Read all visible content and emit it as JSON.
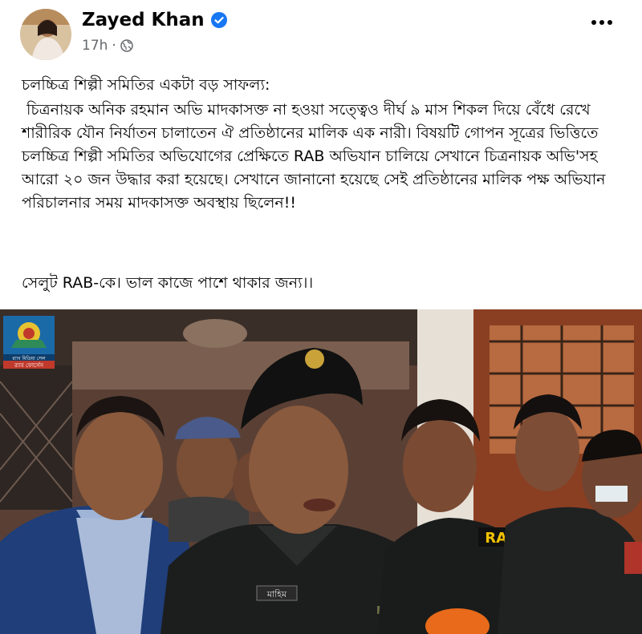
{
  "post": {
    "author": "Zayed Khan",
    "time": "17h",
    "privacy_icon": "globe-icon",
    "verified_icon": "verified-badge-icon",
    "more_icon": "more-options-icon",
    "paragraph_1": "চলচ্চিত্র শিল্পী সমিতির একটা বড় সাফল্য:",
    "paragraph_2": "চিত্রনায়ক অনিক রহমান অভি মাদকাসক্ত না হওয়া সত্ত্বেও দীর্ঘ ৯ মাস শিকল দিয়ে বেঁধে রেখে শারীরিক যৌন নির্যাতন চালাতেন ঐ প্রতিষ্ঠানের মালিক এক নারী। বিষয়টি গোপন সূত্রের ভিত্তিতে চলচ্চিত্র শিল্পী সমিতির অভিযোগের প্রেক্ষিতে RAB অভিযান চালিয়ে সেখানে চিত্রনায়ক অভি'সহ আরো ২০ জন উদ্ধার করা হয়েছে। সেখানে জানানো হয়েছে সেই প্রতিষ্ঠানের মালিক পক্ষ অভিযান পরিচালনার সময় মাদকাসক্ত অবস্থায় ছিলেন!!",
    "paragraph_3": "সেলুট RAB-কে। ভাল কাজে পাশে থাকার জন্য।।"
  },
  "photo": {
    "badge_text": "RAB",
    "logo_caption_1": "র‌্যাব মিডিয়া সেল",
    "logo_caption_2": "র‌্যাব ফোর্সেস",
    "name_tag": "মাহিম",
    "colors": {
      "uniform": "#1c1e1d",
      "suit": "#1f3e7a",
      "beret": "#111111",
      "rab_yellow": "#f2c200"
    }
  },
  "colors": {
    "verified": "#1877f2",
    "meta": "#65676b",
    "text": "#050505"
  }
}
